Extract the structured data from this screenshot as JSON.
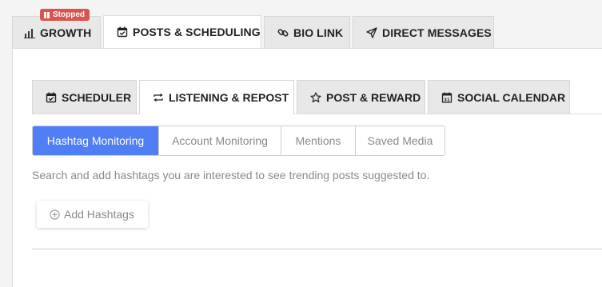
{
  "status_badge": {
    "label": "Stopped",
    "icon": "pause-icon",
    "color": "#d9534f"
  },
  "main_tabs": [
    {
      "label": "GROWTH",
      "icon": "bar-chart-icon",
      "active": false
    },
    {
      "label": "POSTS & SCHEDULING",
      "icon": "calendar-check-icon",
      "active": true
    },
    {
      "label": "BIO LINK",
      "icon": "link-icon",
      "active": false
    },
    {
      "label": "DIRECT MESSAGES",
      "icon": "send-icon",
      "active": false
    }
  ],
  "sub_tabs": [
    {
      "label": "SCHEDULER",
      "icon": "calendar-check-icon",
      "active": false
    },
    {
      "label": "LISTENING & REPOST",
      "icon": "repost-icon",
      "active": true
    },
    {
      "label": "POST & REWARD",
      "icon": "star-icon",
      "active": false
    },
    {
      "label": "SOCIAL CALENDAR",
      "icon": "calendar-day-icon",
      "active": false
    }
  ],
  "segments": [
    {
      "label": "Hashtag Monitoring",
      "active": true
    },
    {
      "label": "Account Monitoring",
      "active": false
    },
    {
      "label": "Mentions",
      "active": false
    },
    {
      "label": "Saved Media",
      "active": false
    }
  ],
  "hint_text": "Search and add hashtags you are interested to see trending posts suggested to.",
  "add_button": {
    "label": "Add Hashtags",
    "icon": "plus-circle-icon"
  },
  "colors": {
    "accent": "#4f7ef5",
    "badge": "#d9534f"
  }
}
